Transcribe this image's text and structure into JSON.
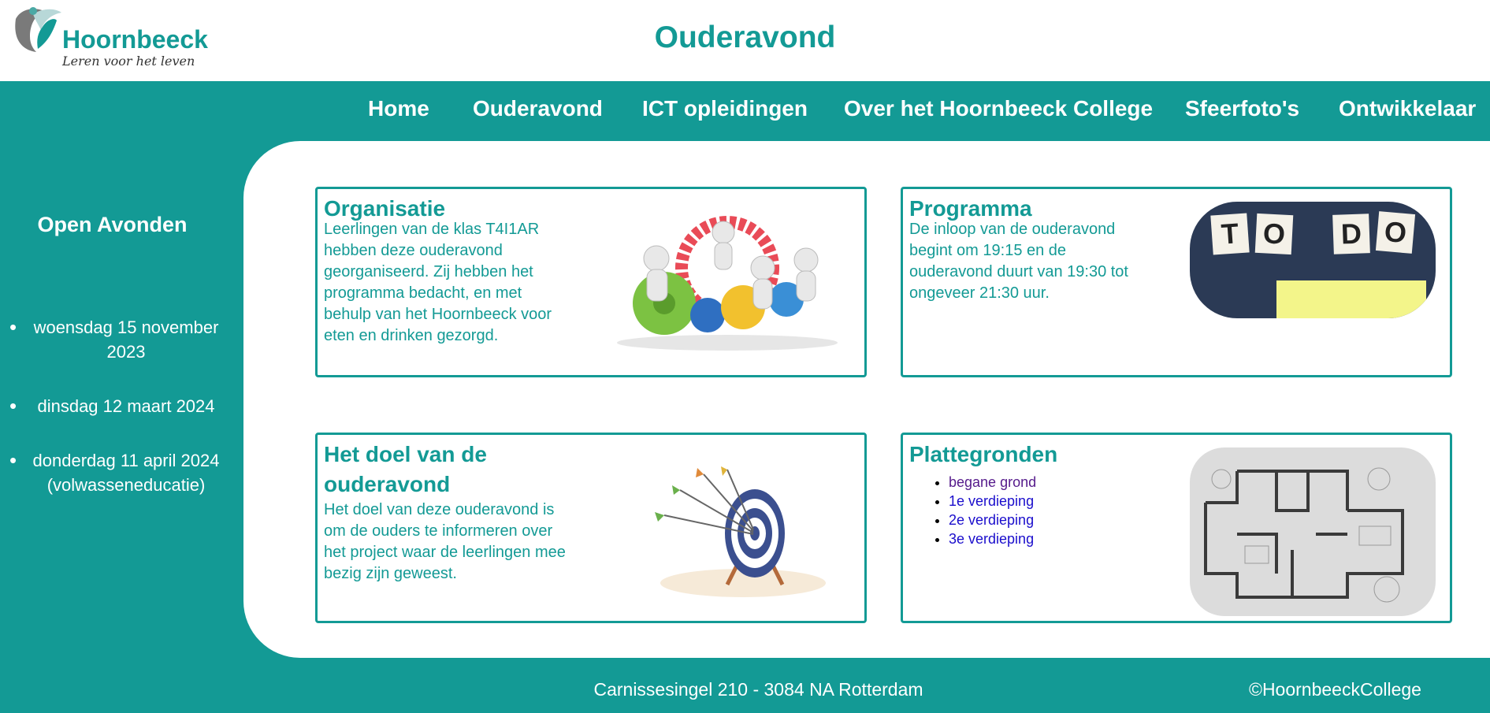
{
  "header": {
    "logo_name": "Hoornbeeck",
    "logo_tagline": "Leren voor het leven",
    "title": "Ouderavond"
  },
  "nav": {
    "items": [
      {
        "label": "Home"
      },
      {
        "label": "Ouderavond"
      },
      {
        "label": "ICT opleidingen"
      },
      {
        "label": "Over het Hoornbeeck College"
      },
      {
        "label": "Sfeerfoto's"
      },
      {
        "label": "Ontwikkelaar"
      }
    ]
  },
  "sidebar": {
    "title": "Open Avonden",
    "dates": [
      "woensdag 15 november 2023",
      "dinsdag 12 maart 2024",
      "donderdag 11 april 2024 (volwasseneducatie)"
    ]
  },
  "cards": {
    "organisatie": {
      "title": "Organisatie",
      "text": "Leerlingen van de klas T4I1AR hebben deze ouderavond georganiseerd. Zij hebben het programma bedacht, en met behulp van het Hoornbeeck voor eten en drinken gezorgd.",
      "image": "gears-teamwork-illustration"
    },
    "programma": {
      "title": "Programma",
      "text": "De inloop van de ouderavond begint om 19:15 en de ouderavond duurt van 19:30 tot ongeveer 21:30 uur.",
      "image": "todo-scrabble-tiles",
      "tiles": [
        "T",
        "O",
        "D",
        "O"
      ]
    },
    "doel": {
      "title": "Het doel van de ouderavond",
      "text": "Het doel van deze ouderavond is om de ouders te informeren over het project waar de leerlingen mee bezig zijn geweest.",
      "image": "target-with-arrows-illustration"
    },
    "plattegronden": {
      "title": "Plattegronden",
      "links": [
        {
          "label": "begane grond",
          "visited": true
        },
        {
          "label": "1e verdieping",
          "visited": false
        },
        {
          "label": "2e verdieping",
          "visited": false
        },
        {
          "label": "3e verdieping",
          "visited": false
        }
      ],
      "image": "floor-plan-drawing"
    }
  },
  "footer": {
    "address": "Carnissesingel 210 - 3084 NA Rotterdam",
    "copyright": "©HoornbeeckCollege"
  },
  "colors": {
    "brand_teal": "#139a95",
    "link": "#1a0dcc",
    "link_visited": "#551a8b"
  }
}
